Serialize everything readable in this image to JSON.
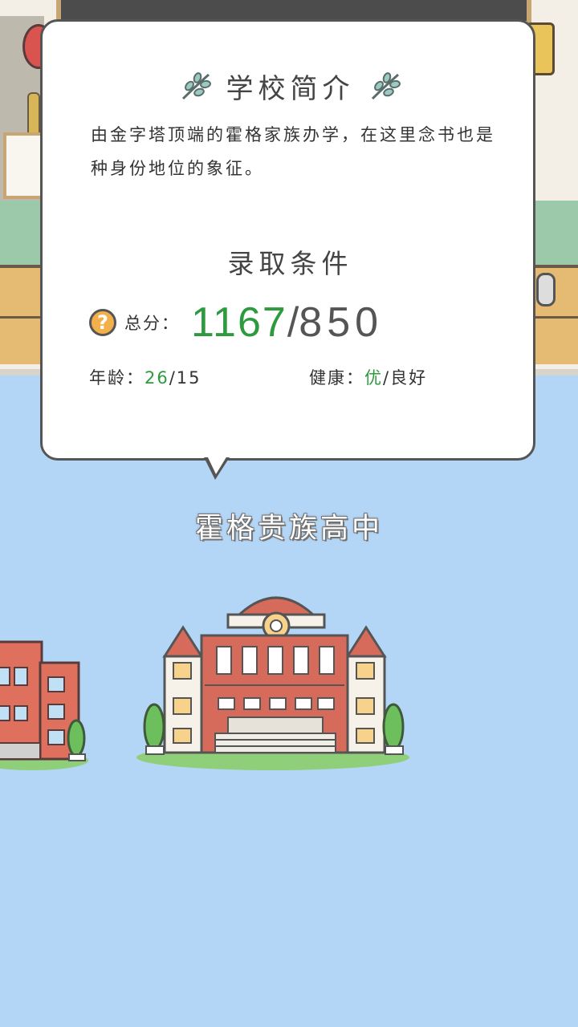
{
  "popup": {
    "title": "学校简介",
    "description": "由金字塔顶端的霍格家族办学，在这里念书也是种身份地位的象征。",
    "requirements_title": "录取条件",
    "score_label": "总分：",
    "score_value": "1167",
    "score_separator": "/",
    "score_required": "850",
    "age_label": "年龄：",
    "age_value": "26",
    "age_required": "/15",
    "health_label": "健康：",
    "health_value": "优",
    "health_required": "/良好"
  },
  "school": {
    "name": "霍格贵族高中"
  },
  "icons": {
    "help": "question-mark-icon",
    "decor": "leaf-branch-icon"
  },
  "colors": {
    "highlight_green": "#2e9a3e",
    "help_orange": "#f3b04a",
    "background_blue": "#b4d6f6"
  }
}
